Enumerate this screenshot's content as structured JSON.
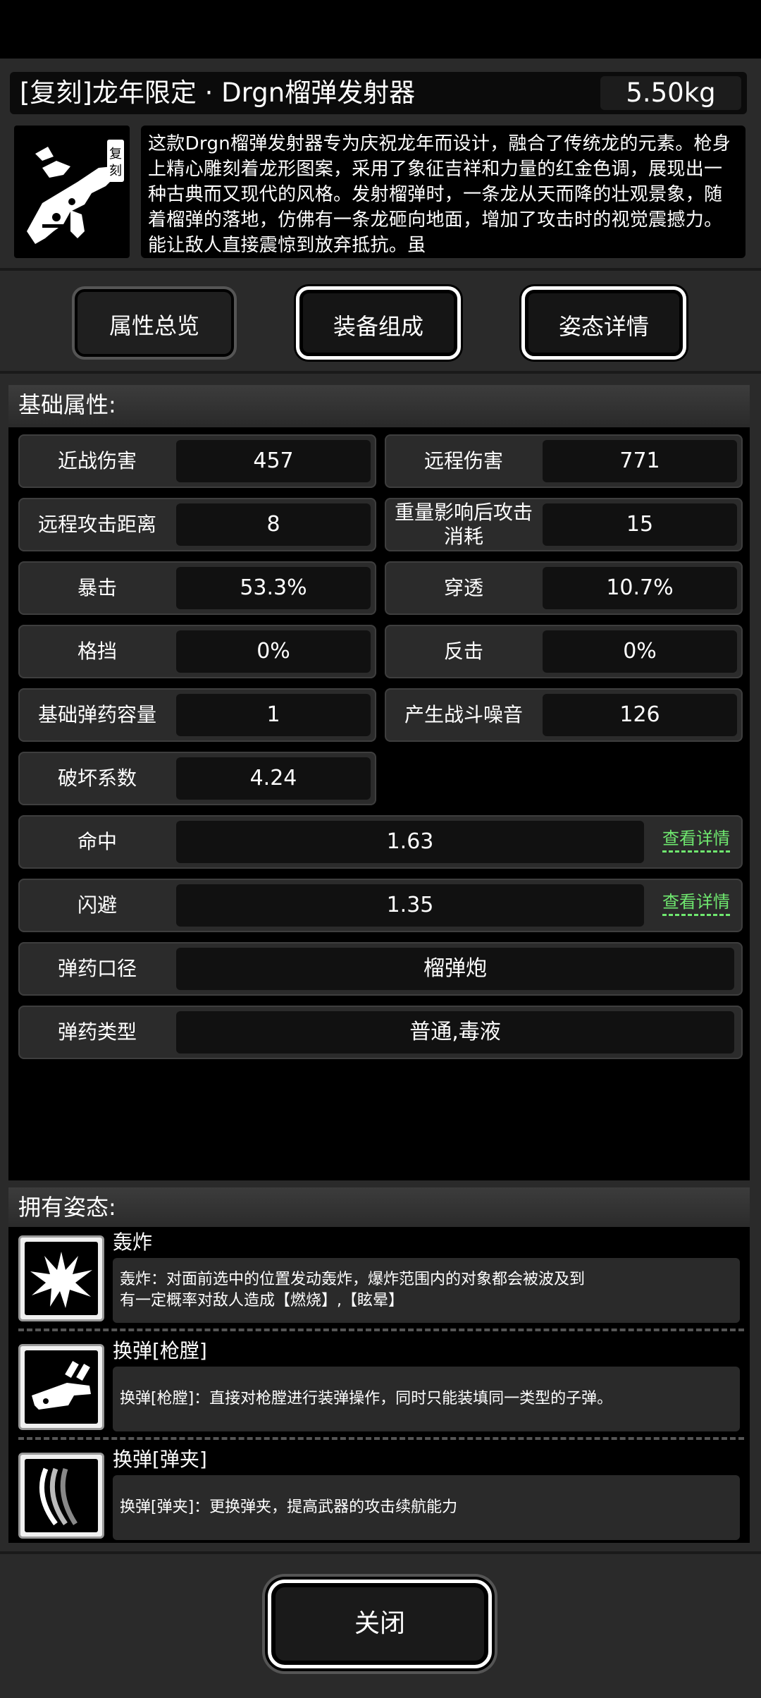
{
  "header": {
    "title": "[复刻]龙年限定 · Drgn榴弹发射器",
    "weight": "5.50kg",
    "badge": "复刻",
    "description": "这款Drgn榴弹发射器专为庆祝龙年而设计，融合了传统龙的元素。枪身上精心雕刻着龙形图案，采用了象征吉祥和力量的红金色调，展现出一种古典而又现代的风格。发射榴弹时，一条龙从天而降的壮观景象，随着榴弹的落地，仿佛有一条龙砸向地面，增加了攻击时的视觉震撼力。能让敌人直接震惊到放弃抵抗。虽"
  },
  "tabs": [
    {
      "label": "属性总览",
      "state": "inactive"
    },
    {
      "label": "装备组成",
      "state": "active"
    },
    {
      "label": "姿态详情",
      "state": "active"
    }
  ],
  "base_attrs": {
    "heading": "基础属性:",
    "pairs": [
      {
        "label": "近战伤害",
        "value": "457"
      },
      {
        "label": "远程伤害",
        "value": "771"
      },
      {
        "label": "远程攻击距离",
        "value": "8"
      },
      {
        "label": "重量影响后攻击消耗",
        "value": "15"
      },
      {
        "label": "暴击",
        "value": "53.3%"
      },
      {
        "label": "穿透",
        "value": "10.7%"
      },
      {
        "label": "格挡",
        "value": "0%"
      },
      {
        "label": "反击",
        "value": "0%"
      },
      {
        "label": "基础弹药容量",
        "value": "1"
      },
      {
        "label": "产生战斗噪音",
        "value": "126"
      },
      {
        "label": "破坏系数",
        "value": "4.24"
      }
    ],
    "wide": [
      {
        "label": "命中",
        "value": "1.63",
        "link": "查看详情"
      },
      {
        "label": "闪避",
        "value": "1.35",
        "link": "查看详情"
      },
      {
        "label": "弹药口径",
        "value": "榴弹炮"
      },
      {
        "label": "弹药类型",
        "value": "普通,毒液"
      }
    ]
  },
  "stances": {
    "heading": "拥有姿态:",
    "items": [
      {
        "name": "轰炸",
        "icon": "explosion-icon",
        "desc_line1": "轰炸：对面前选中的位置发动轰炸，爆炸范围内的对象都会被波及到",
        "desc_line2": "有一定概率对敌人造成【燃烧】,【眩晕】"
      },
      {
        "name": "换弹[枪膛]",
        "icon": "bullet-chamber-icon",
        "desc_line1": "换弹[枪膛]：直接对枪膛进行装弹操作，同时只能装填同一类型的子弹。",
        "desc_line2": ""
      },
      {
        "name": "换弹[弹夹]",
        "icon": "magazine-icon",
        "desc_line1": "换弹[弹夹]：更换弹夹，提高武器的攻击续航能力",
        "desc_line2": ""
      }
    ]
  },
  "footer": {
    "close_label": "关闭"
  }
}
